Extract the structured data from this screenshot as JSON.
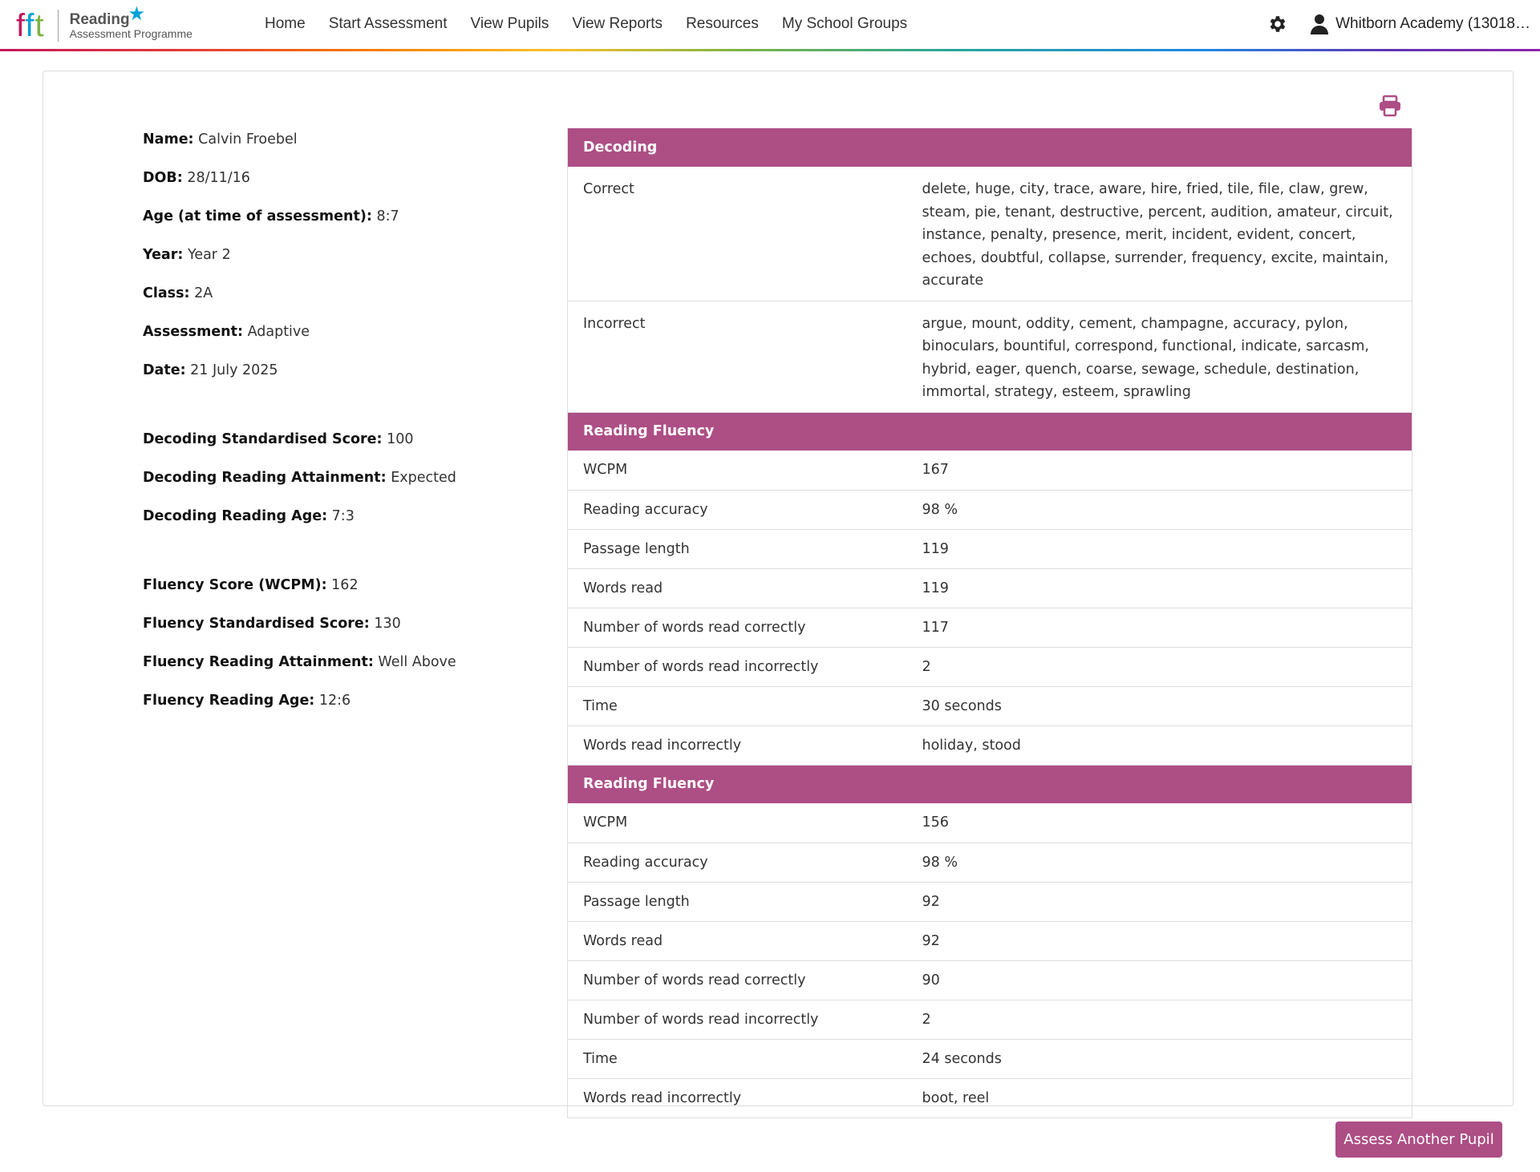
{
  "header": {
    "logo": {
      "brand": "fft",
      "product": "Reading",
      "subtitle": "Assessment Programme"
    },
    "nav": [
      "Home",
      "Start Assessment",
      "View Pupils",
      "View Reports",
      "Resources",
      "My School Groups"
    ],
    "school": "Whitborn Academy (13018…"
  },
  "pupil": {
    "name_label": "Name:",
    "name": "Calvin Froebel",
    "dob_label": "DOB:",
    "dob": "28/11/16",
    "age_label": "Age (at time of assessment):",
    "age": "8:7",
    "year_label": "Year:",
    "year": "Year 2",
    "class_label": "Class:",
    "class": "2A",
    "assessment_label": "Assessment:",
    "assessment": "Adaptive",
    "date_label": "Date:",
    "date": "21 July 2025",
    "dss_label": "Decoding Standardised Score:",
    "dss": "100",
    "dra_label": "Decoding Reading Attainment:",
    "dra": "Expected",
    "drage_label": "Decoding Reading Age:",
    "drage": "7:3",
    "fs_label": "Fluency Score (WCPM):",
    "fs": "162",
    "fss_label": "Fluency Standardised Score:",
    "fss": "130",
    "fra_label": "Fluency Reading Attainment:",
    "fra": "Well Above",
    "frage_label": "Fluency Reading Age:",
    "frage": "12:6"
  },
  "decoding": {
    "title": "Decoding",
    "correct_label": "Correct",
    "correct": "delete, huge, city, trace, aware, hire, fried, tile, file, claw, grew, steam, pie, tenant, destructive, percent, audition, amateur, circuit, instance, penalty, presence, merit, incident, evident, concert, echoes, doubtful, collapse, surrender, frequency, excite, maintain, accurate",
    "incorrect_label": "Incorrect",
    "incorrect": "argue, mount, oddity, cement, champagne, accuracy, pylon, binoculars, bountiful, correspond, functional, indicate, sarcasm, hybrid, eager, quench, coarse, sewage, schedule, destination, immortal, strategy, esteem, sprawling"
  },
  "fluency1": {
    "title": "Reading Fluency",
    "rows": [
      {
        "k": "WCPM",
        "v": "167"
      },
      {
        "k": "Reading accuracy",
        "v": "98 %"
      },
      {
        "k": "Passage length",
        "v": "119"
      },
      {
        "k": "Words read",
        "v": "119"
      },
      {
        "k": "Number of words read correctly",
        "v": "117"
      },
      {
        "k": "Number of words read incorrectly",
        "v": "2"
      },
      {
        "k": "Time",
        "v": "30 seconds"
      },
      {
        "k": "Words read incorrectly",
        "v": "holiday, stood"
      }
    ]
  },
  "fluency2": {
    "title": "Reading Fluency",
    "rows": [
      {
        "k": "WCPM",
        "v": "156"
      },
      {
        "k": "Reading accuracy",
        "v": "98 %"
      },
      {
        "k": "Passage length",
        "v": "92"
      },
      {
        "k": "Words read",
        "v": "92"
      },
      {
        "k": "Number of words read correctly",
        "v": "90"
      },
      {
        "k": "Number of words read incorrectly",
        "v": "2"
      },
      {
        "k": "Time",
        "v": "24 seconds"
      },
      {
        "k": "Words read incorrectly",
        "v": "boot, reel"
      }
    ]
  },
  "actions": {
    "assess_another": "Assess Another Pupil"
  },
  "colors": {
    "accent": "#ad4e85",
    "nav_text": "#333333"
  },
  "icons": [
    "gear-icon",
    "user-icon",
    "print-icon",
    "star-icon"
  ]
}
